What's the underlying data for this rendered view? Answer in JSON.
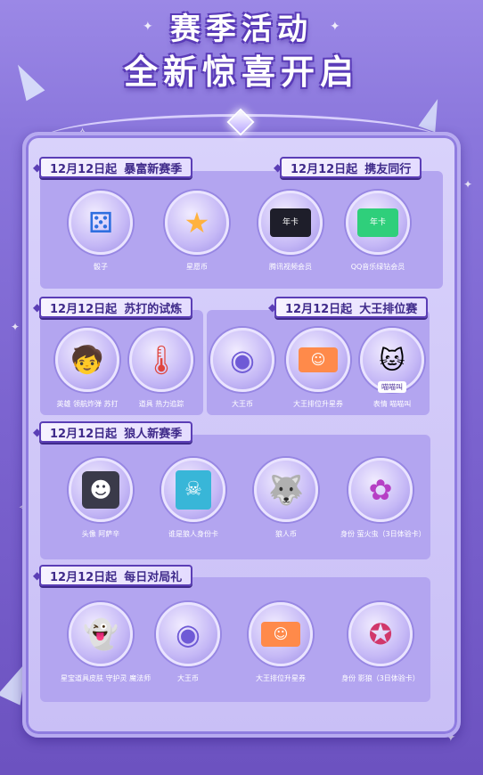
{
  "page": {
    "title_line1": "赛季活动",
    "title_line2": "全新惊喜开启"
  },
  "sections": [
    {
      "id": "s1",
      "date": "12月12日起",
      "name": "暴富新赛季",
      "rewards": [
        {
          "label": "骰子",
          "icon": "dice-icon"
        },
        {
          "label": "星愿币",
          "icon": "star-coin-icon"
        }
      ]
    },
    {
      "id": "s2",
      "date": "12月12日起",
      "name": "携友同行",
      "rewards": [
        {
          "label": "腾讯视频会员",
          "icon": "tencent-video-vip-card-icon",
          "card_text": "年卡"
        },
        {
          "label": "QQ音乐绿钻会员",
          "icon": "qq-music-green-diamond-card-icon",
          "card_text": "年卡"
        }
      ]
    },
    {
      "id": "s3",
      "date": "12月12日起",
      "name": "苏打的试炼",
      "rewards": [
        {
          "label": "英雄 领航炸弹 苏打",
          "icon": "soda-hero-icon"
        },
        {
          "label": "道具 热力追踪",
          "icon": "thermometer-icon"
        }
      ]
    },
    {
      "id": "s4",
      "date": "12月12日起",
      "name": "大王排位赛",
      "rewards": [
        {
          "label": "大王币",
          "icon": "king-coin-icon"
        },
        {
          "label": "大王排位升星券",
          "icon": "rank-star-ticket-icon"
        },
        {
          "label": "表情 喵喵叫",
          "icon": "meow-emote-icon",
          "tag": "喵喵叫"
        }
      ]
    },
    {
      "id": "s5",
      "date": "12月12日起",
      "name": "狼人新赛季",
      "rewards": [
        {
          "label": "头像 阿萨辛",
          "icon": "avatar-assassin-icon"
        },
        {
          "label": "谁是狼人身份卡",
          "icon": "werewolf-identity-card-icon"
        },
        {
          "label": "狼人币",
          "icon": "werewolf-coin-icon"
        },
        {
          "label": "身份 萤火虫（3日体验卡）",
          "icon": "firefly-identity-icon"
        }
      ]
    },
    {
      "id": "s6",
      "date": "12月12日起",
      "name": "每日对局礼",
      "rewards": [
        {
          "label": "星宝道具皮肤 守护灵 魔法师",
          "icon": "ghost-wizard-skin-icon"
        },
        {
          "label": "大王币",
          "icon": "king-coin-icon"
        },
        {
          "label": "大王排位升星券",
          "icon": "rank-star-ticket-icon"
        },
        {
          "label": "身份 影狼（3日体验卡）",
          "icon": "shadow-wolf-identity-icon"
        }
      ]
    }
  ],
  "colors": {
    "background": "#8a76dc",
    "panel": "#b3a5f0",
    "header_text": "#3f2a8a",
    "header_border": "#5b3eb6",
    "title_text": "#ffffff"
  }
}
